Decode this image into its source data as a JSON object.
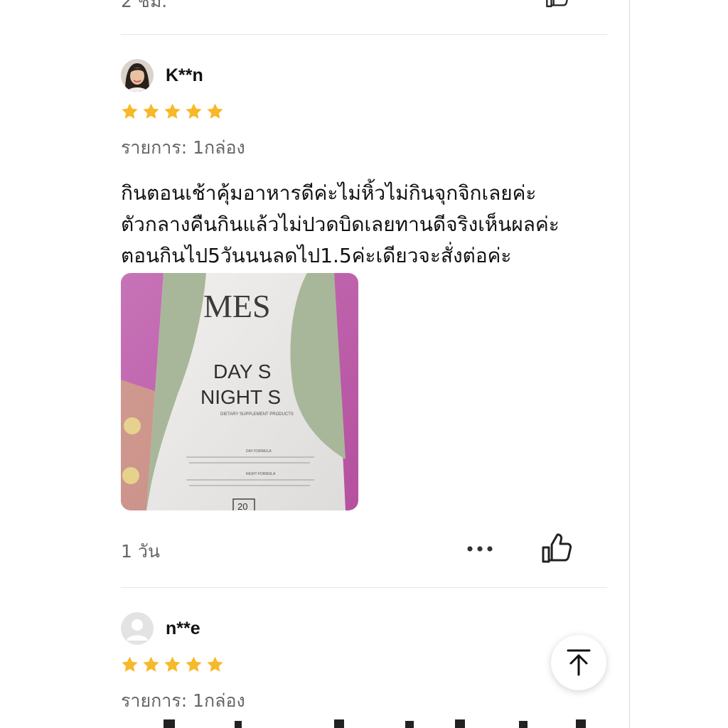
{
  "previous_review": {
    "time_text": "2 ชม."
  },
  "reviews": [
    {
      "username": "K**n",
      "rating": 5,
      "item_label": "รายการ: 1กล่อง",
      "text_lines": [
        "กินตอนเช้าคุ้มอาหารดีค่ะไม่หิ้วไม่กินจุกจิกเลยค่ะ",
        "ตัวกลางคืนกินแล้วไม่ปวดบิดเลยทานดีจริงเห็นผลค่ะ",
        "ตอนกินไป5วันนนลดไป1.5ค่ะเดียวจะสั่งต่อค่ะ"
      ],
      "photo": {
        "brand": "MES",
        "product_line1": "DAY S",
        "product_line2": "NIGHT S",
        "subtitle": "DIETARY SUPPLEMENT PRODUCTS",
        "day_formula": "DAY FORMULA",
        "night_formula": "NIGHT FORMULA",
        "count": "20"
      },
      "time_text": "1 วัน"
    },
    {
      "username": "n**e",
      "rating": 5,
      "item_label": "รายการ: 1กล่อง"
    }
  ],
  "icons": {
    "star": "star-icon",
    "like": "thumbs-up-icon",
    "more": "more-dots-icon",
    "scroll_top": "arrow-up-to-top-icon"
  },
  "colors": {
    "star": "#F7B928",
    "muted_text": "#666666",
    "divider": "#E6E6E6",
    "product_green": "#A8B79A"
  }
}
